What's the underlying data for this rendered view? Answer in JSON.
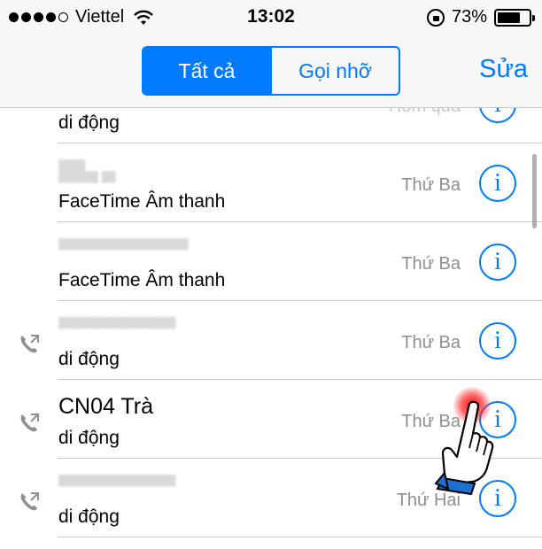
{
  "status_bar": {
    "carrier": "Viettel",
    "time": "13:02",
    "battery_percent": "73%",
    "battery_level": 0.73,
    "signal_bars_filled": 4,
    "signal_bars_total": 5,
    "icons": [
      "signal-dots-icon",
      "wifi-icon",
      "rotation-lock-icon",
      "battery-icon"
    ]
  },
  "nav": {
    "segments": [
      {
        "label": "Tất cả",
        "selected": true
      },
      {
        "label": "Gọi nhỡ",
        "selected": false
      }
    ],
    "edit_label": "Sửa"
  },
  "calls": [
    {
      "name": "",
      "type": "di động",
      "when": "Hôm qua",
      "name_obscured": false,
      "outgoing_icon": false
    },
    {
      "name": "",
      "type": "FaceTime Âm thanh",
      "when": "Thứ Ba",
      "name_obscured": true,
      "outgoing_icon": false
    },
    {
      "name": "",
      "type": "FaceTime Âm thanh",
      "when": "Thứ Ba",
      "name_obscured": true,
      "outgoing_icon": false
    },
    {
      "name": "",
      "type": "di động",
      "when": "Thứ Ba",
      "name_obscured": true,
      "outgoing_icon": true
    },
    {
      "name": "CN04 Trà",
      "type": "di động",
      "when": "Thứ Ba",
      "name_obscured": false,
      "outgoing_icon": true
    },
    {
      "name": "",
      "type": "di động",
      "when": "Thứ Hai",
      "name_obscured": true,
      "outgoing_icon": true
    }
  ],
  "info_glyph": "i",
  "colors": {
    "accent": "#007aff",
    "secondary_text": "#8e8e93",
    "separator": "#c8c7cc",
    "bar_background": "#f7f7f7",
    "tap_indicator": "#ff0000",
    "hand_cuff": "#1f6fd1"
  }
}
